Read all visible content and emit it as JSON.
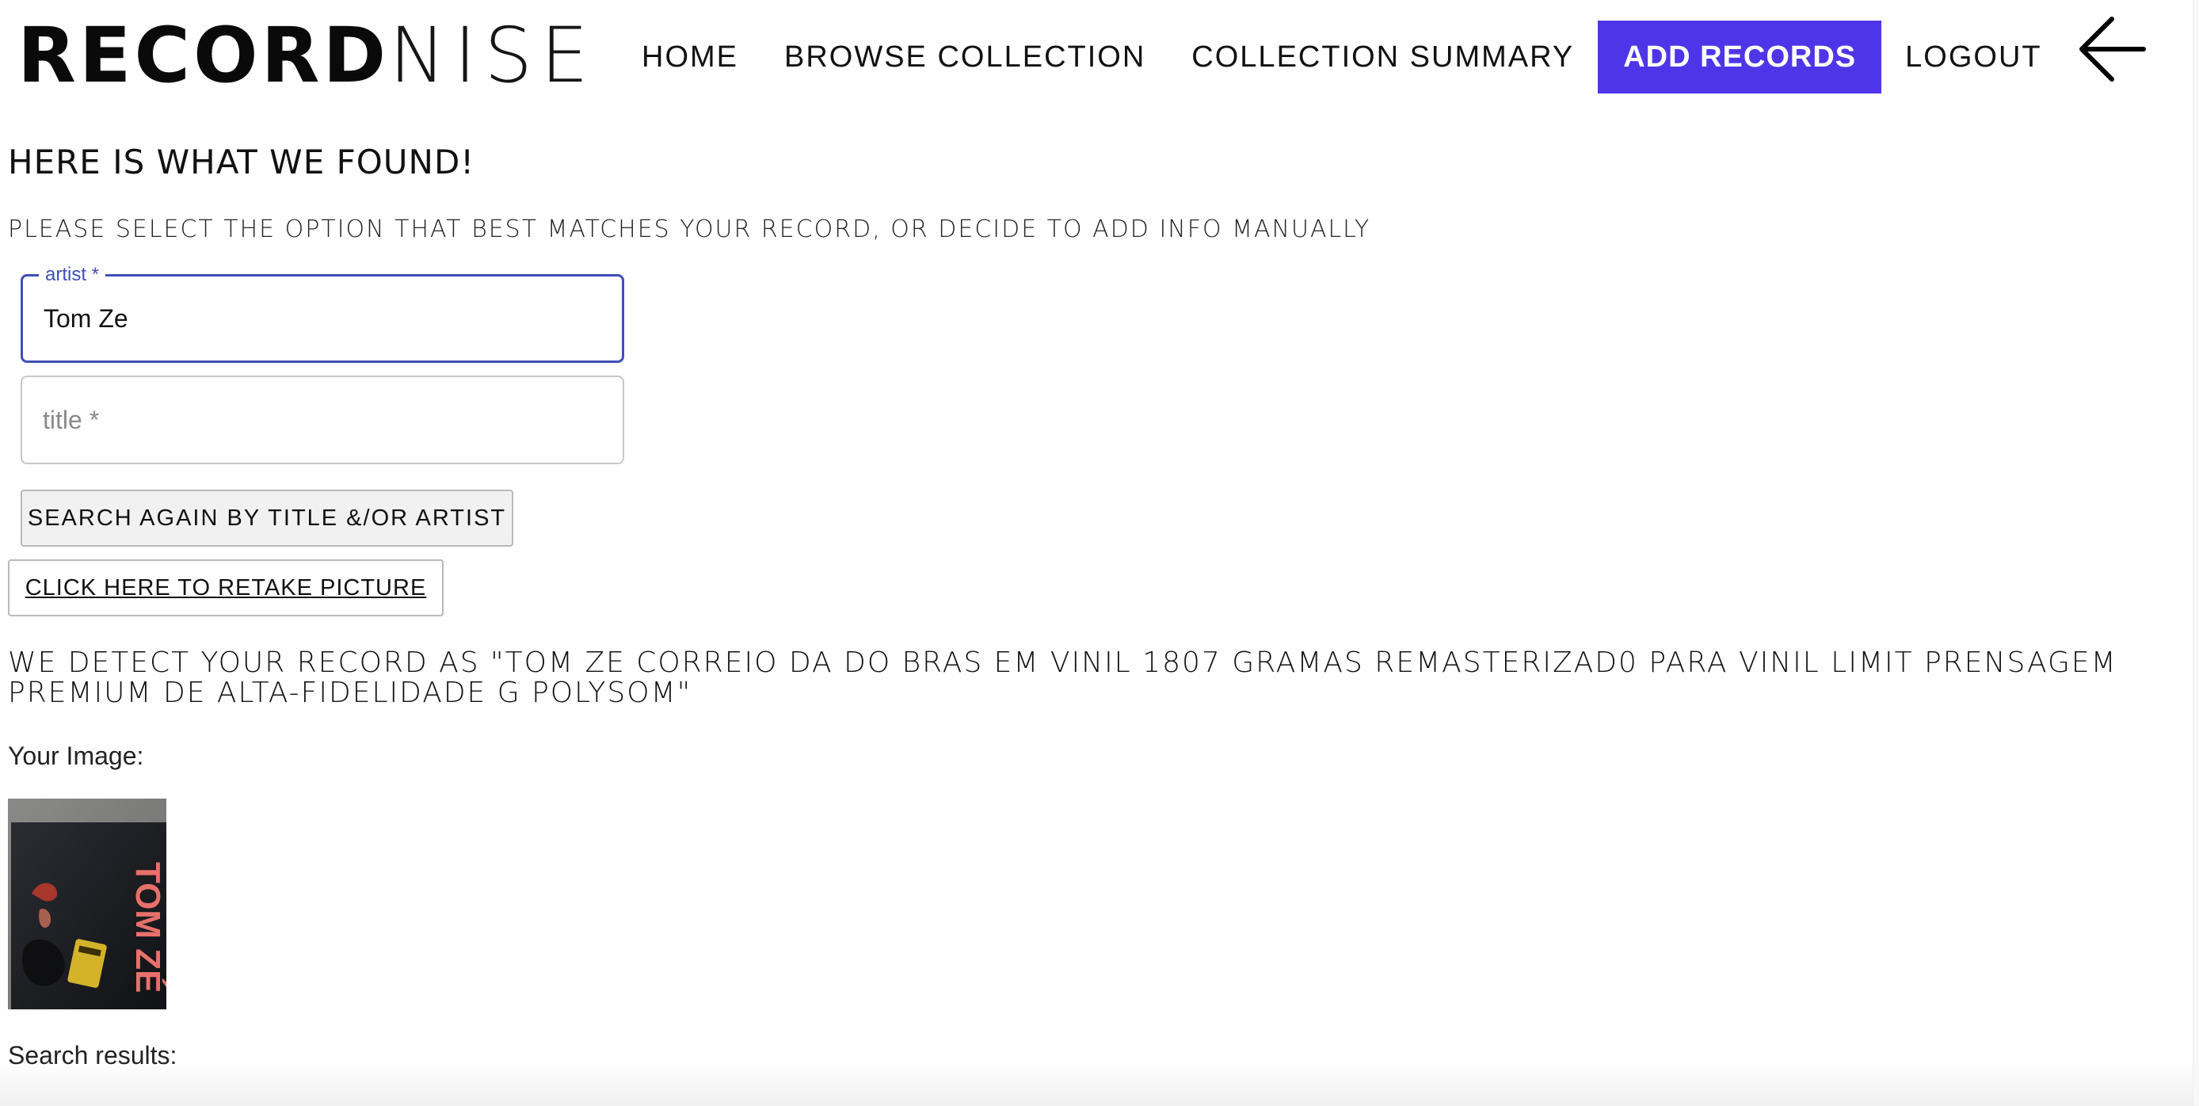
{
  "logo": {
    "bold": "RECORD",
    "thin": "NISE"
  },
  "nav": {
    "items": [
      {
        "label": "HOME"
      },
      {
        "label": "BROWSE COLLECTION"
      },
      {
        "label": "COLLECTION SUMMARY"
      },
      {
        "label": "ADD RECORDS",
        "active": true
      },
      {
        "label": "LOGOUT"
      }
    ]
  },
  "heading": "HERE IS WHAT WE FOUND!",
  "subheading": "PLEASE SELECT THE OPTION THAT BEST MATCHES YOUR RECORD, OR DECIDE TO ADD INFO MANUALLY",
  "form": {
    "artist": {
      "label": "artist *",
      "value": "Tom Ze"
    },
    "title": {
      "placeholder": "title *",
      "value": ""
    },
    "search_button": "SEARCH AGAIN BY TITLE &/OR ARTIST",
    "retake_button": "CLICK HERE TO RETAKE PICTURE"
  },
  "detect_text": "WE DETECT YOUR RECORD AS \"TOM ZE CORREIO DA DO BRAS EM VINIL 1807 GRAMAS REMASTERIZAD0 PARA VINIL LIMIT PRENSAGEM PREMIUM DE ALTA-FIDELIDADE G POLYSOM\"",
  "your_image_label": "Your Image:",
  "image": {
    "cover_text": "TOM ZÉ"
  },
  "search_results_label": "Search results:",
  "colors": {
    "accent": "#4f35e8",
    "focus": "#3f4fb8"
  },
  "icons": {
    "back": "arrow-left-icon"
  }
}
